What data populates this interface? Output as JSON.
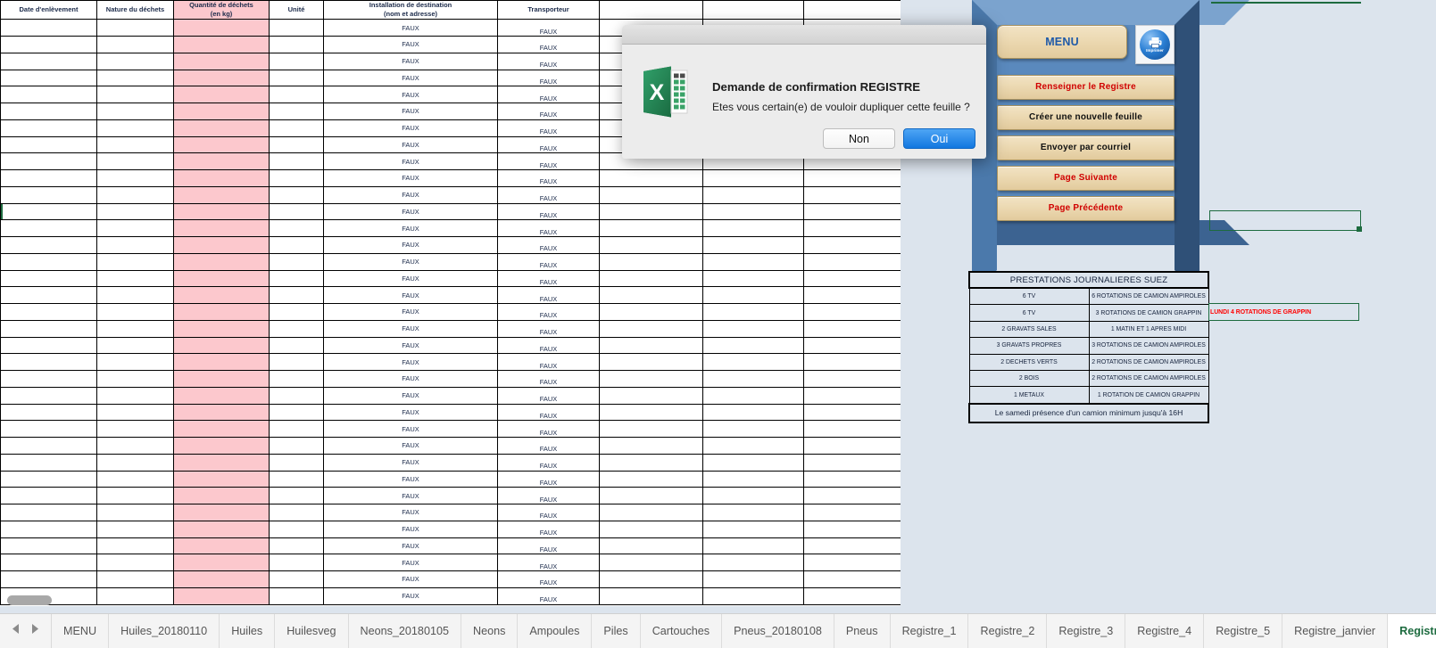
{
  "grid": {
    "headers": [
      "Date d'enlèvement",
      "Nature du déchets",
      "Quantité de déchets\n(en kg)",
      "Unité",
      "Installation de destination\n(nom et adresse)",
      "Transporteur",
      "",
      "",
      ""
    ],
    "header_lines": {
      "c0": "Date d'enlèvement",
      "c1": "Nature du déchets",
      "c2_l1": "Quantité de déchets",
      "c2_l2": "(en kg)",
      "c3": "Unité",
      "c4_l1": "Installation de destination",
      "c4_l2": "(nom et adresse)",
      "c5": "Transporteur"
    },
    "cell_value": "FAUX",
    "row_count": 35,
    "selected_row_index": 11,
    "highlight_color": "#fcc8cd",
    "selection_color": "#1d6b3f"
  },
  "panel": {
    "menu_label": "MENU",
    "print_label": "Imprimer",
    "buttons": [
      {
        "label": "Renseigner le Registre",
        "style": "red"
      },
      {
        "label": "Créer une nouvelle feuille",
        "style": "black"
      },
      {
        "label": "Envoyer par courriel",
        "style": "black"
      },
      {
        "label": "Page Suivante",
        "style": "red"
      },
      {
        "label": "Page Précédente",
        "style": "red"
      }
    ]
  },
  "prestations": {
    "title": "PRESTATIONS JOURNALIERES SUEZ",
    "rows": [
      [
        "6 TV",
        "6 ROTATIONS DE CAMION AMPIROLES"
      ],
      [
        "6 TV",
        "3 ROTATIONS DE CAMION GRAPPIN"
      ],
      [
        "2 GRAVATS SALES",
        "1  MATIN ET 1 APRES MIDI"
      ],
      [
        "3 GRAVATS PROPRES",
        "3 ROTATIONS DE CAMION AMPIROLES"
      ],
      [
        "2 DECHETS VERTS",
        "2 ROTATIONS DE CAMION AMPIROLES"
      ],
      [
        "2 BOIS",
        "2 ROTATIONS DE CAMION AMPIROLES"
      ],
      [
        "1 METAUX",
        "1 ROTATION DE CAMION GRAPPIN"
      ]
    ],
    "footer": "Le samedi présence d'un camion minimum jusqu'à 16H",
    "note": "LUNDI 4 ROTATIONS DE GRAPPIN",
    "note_color": "#ff0000"
  },
  "dialog": {
    "title": "Demande de confirmation REGISTRE",
    "message": "Etes vous certain(e) de vouloir dupliquer cette feuille ?",
    "cancel_label": "Non",
    "confirm_label": "Oui",
    "icon": "excel-icon"
  },
  "tabs": {
    "items": [
      "MENU",
      "Huiles_20180110",
      "Huiles",
      "Huilesveg",
      "Neons_20180105",
      "Neons",
      "Ampoules",
      "Piles",
      "Cartouches",
      "Pneus_20180108",
      "Pneus",
      "Registre_1",
      "Registre_2",
      "Registre_3",
      "Registre_4",
      "Registre_5",
      "Registre_janvier",
      "Registre"
    ],
    "active": "Registre",
    "prev_icon": "prev-sheet-arrow",
    "next_icon": "next-sheet-arrow"
  }
}
